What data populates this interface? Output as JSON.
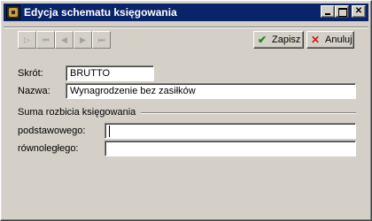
{
  "window": {
    "title": "Edycja schematu księgowania",
    "controls": {
      "minimize": "",
      "maximize": "",
      "close": "✕"
    }
  },
  "toolbar": {
    "nav": [
      {
        "icon": "first-record-icon",
        "glyph": "▷"
      },
      {
        "icon": "skip-first-icon",
        "glyph": "⏮"
      },
      {
        "icon": "previous-icon",
        "glyph": "◀"
      },
      {
        "icon": "next-icon",
        "glyph": "▶"
      },
      {
        "icon": "skip-last-icon",
        "glyph": "⏭"
      }
    ],
    "save_label": "Zapisz",
    "save_icon": "✔",
    "cancel_label": "Anuluj",
    "cancel_icon": "✕"
  },
  "form": {
    "short_label": "Skrót:",
    "short_value": "BRUTTO",
    "name_label": "Nazwa:",
    "name_value": "Wynagrodzenie bez zasiłków",
    "group_title": "Suma rozbicia księgowania",
    "basic_label": "podstawowego:",
    "basic_value": "",
    "parallel_label": "równoległego:",
    "parallel_value": ""
  }
}
